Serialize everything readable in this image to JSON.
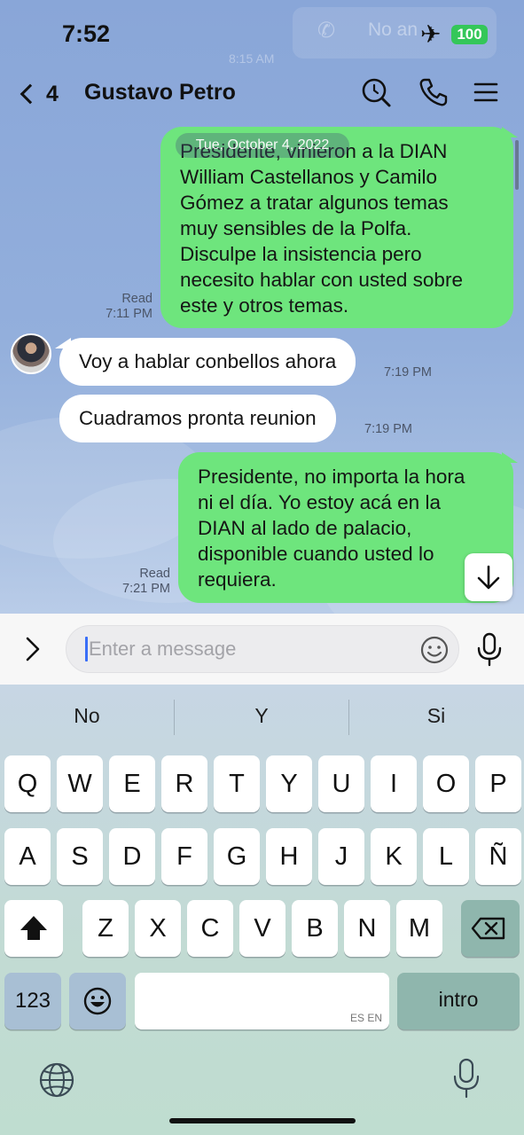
{
  "status_bar": {
    "time": "7:52",
    "battery": "100"
  },
  "ghost_notification": {
    "text": "No an",
    "time": "8:15 AM"
  },
  "header": {
    "back_count": "4",
    "title": "Gustavo Petro"
  },
  "chat": {
    "date_separator": "Tue, October 4, 2022",
    "messages": [
      {
        "direction": "out",
        "text_lines": [
          "Presidente, vinieron a la DIAN",
          "William Castellanos y Camilo",
          "Gómez a tratar algunos temas",
          "muy sensibles de la Polfa.",
          "Disculpe la insistencia pero",
          "necesito hablar con usted sobre",
          "este y otros temas."
        ],
        "read": "Read",
        "time": "7:11 PM"
      },
      {
        "direction": "in",
        "text": "Voy a hablar conbellos ahora",
        "time": "7:19 PM"
      },
      {
        "direction": "in",
        "text": "Cuadramos pronta reunion",
        "time": "7:19 PM"
      },
      {
        "direction": "out",
        "text_lines": [
          "Presidente, no importa la hora",
          "ni el día. Yo estoy acá en la",
          "DIAN al lado de palacio,",
          "disponible cuando usted lo",
          "requiera."
        ],
        "read": "Read",
        "time": "7:21 PM"
      }
    ]
  },
  "input": {
    "placeholder": "Enter a message"
  },
  "keyboard": {
    "suggestions": [
      "No",
      "Y",
      "Si"
    ],
    "row1": [
      "Q",
      "W",
      "E",
      "R",
      "T",
      "Y",
      "U",
      "I",
      "O",
      "P"
    ],
    "row2": [
      "A",
      "S",
      "D",
      "F",
      "G",
      "H",
      "J",
      "K",
      "L",
      "Ñ"
    ],
    "row3": [
      "Z",
      "X",
      "C",
      "V",
      "B",
      "N",
      "M"
    ],
    "numbers_key": "123",
    "space_lang": "ES EN",
    "return_key": "intro"
  },
  "colors": {
    "outgoing_bubble": "#6ee57d",
    "incoming_bubble": "#ffffff",
    "battery": "#34c759",
    "caret": "#3a6ff7"
  }
}
